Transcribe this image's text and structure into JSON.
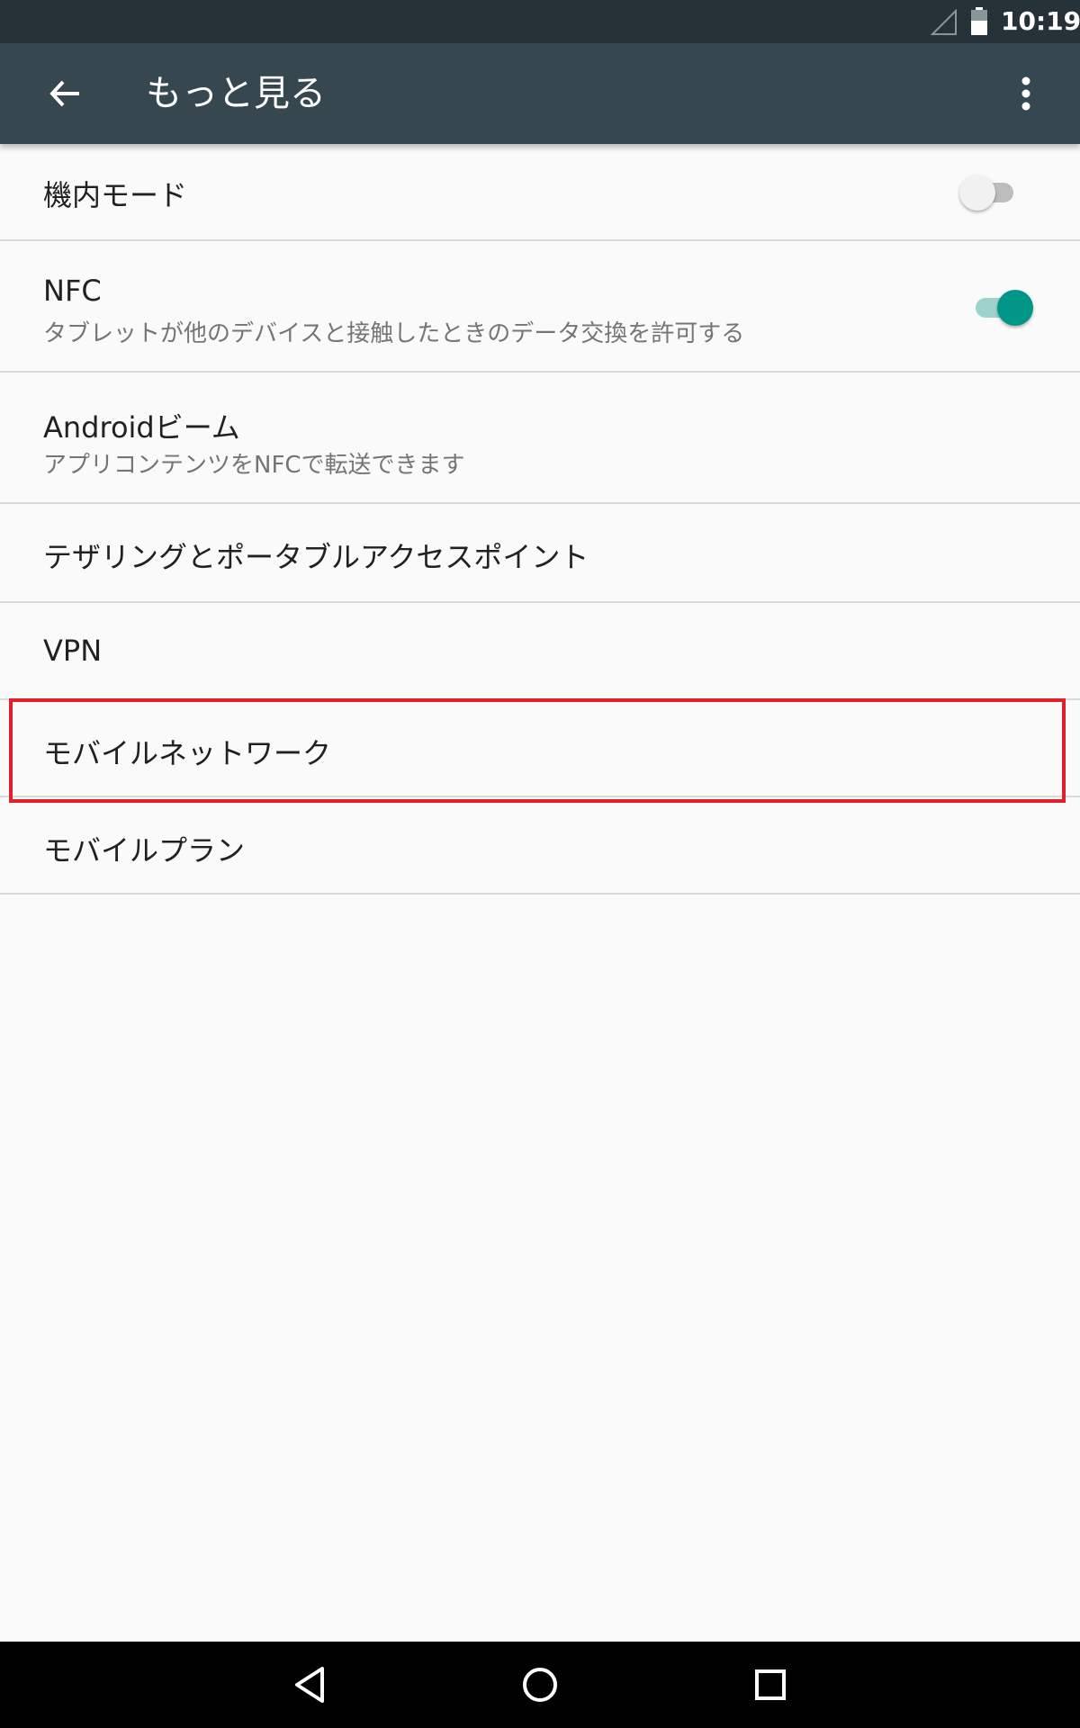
{
  "status_bar": {
    "time": "10:19",
    "signal_icon": "signal-empty-icon",
    "battery_icon": "battery-icon"
  },
  "app_bar": {
    "title": "もっと見る",
    "back_icon": "arrow-back-icon",
    "overflow_icon": "more-vert-icon"
  },
  "settings": {
    "airplane_mode": {
      "label": "機内モード",
      "enabled": false
    },
    "nfc": {
      "label": "NFC",
      "summary": "タブレットが他のデバイスと接触したときのデータ交換を許可する",
      "enabled": true
    },
    "android_beam": {
      "label": "Androidビーム",
      "summary": "アプリコンテンツをNFCで転送できます"
    },
    "tethering": {
      "label": "テザリングとポータブルアクセスポイント"
    },
    "vpn": {
      "label": "VPN"
    },
    "mobile_network": {
      "label": "モバイルネットワーク"
    },
    "mobile_plan": {
      "label": "モバイルプラン"
    }
  },
  "nav_bar": {
    "back_icon": "nav-back-icon",
    "home_icon": "nav-home-icon",
    "recents_icon": "nav-recents-icon"
  },
  "colors": {
    "status_bar": "#263238",
    "app_bar": "#37474f",
    "accent": "#009688",
    "highlight": "#e0202a"
  }
}
